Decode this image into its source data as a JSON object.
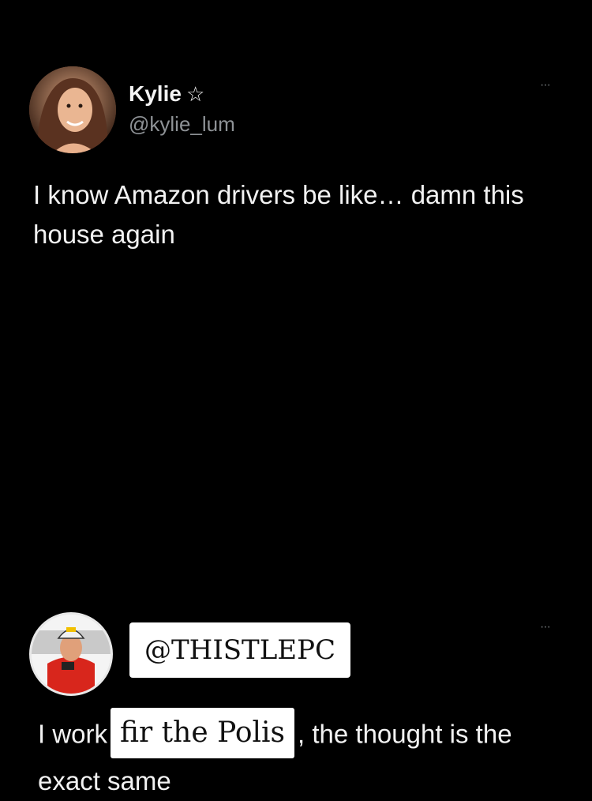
{
  "tweet1": {
    "author_name": "Kylie",
    "verified_star": "☆",
    "handle": "@kylie_lum",
    "more": "···",
    "text": "I know Amazon drivers be like… damn this house again"
  },
  "tweet2": {
    "handle_overlay": "@THISTLEPC",
    "more": "···",
    "text_before": "I work",
    "text_overlay": "fir the Polis",
    "text_after": ", the thought is the exact same"
  }
}
